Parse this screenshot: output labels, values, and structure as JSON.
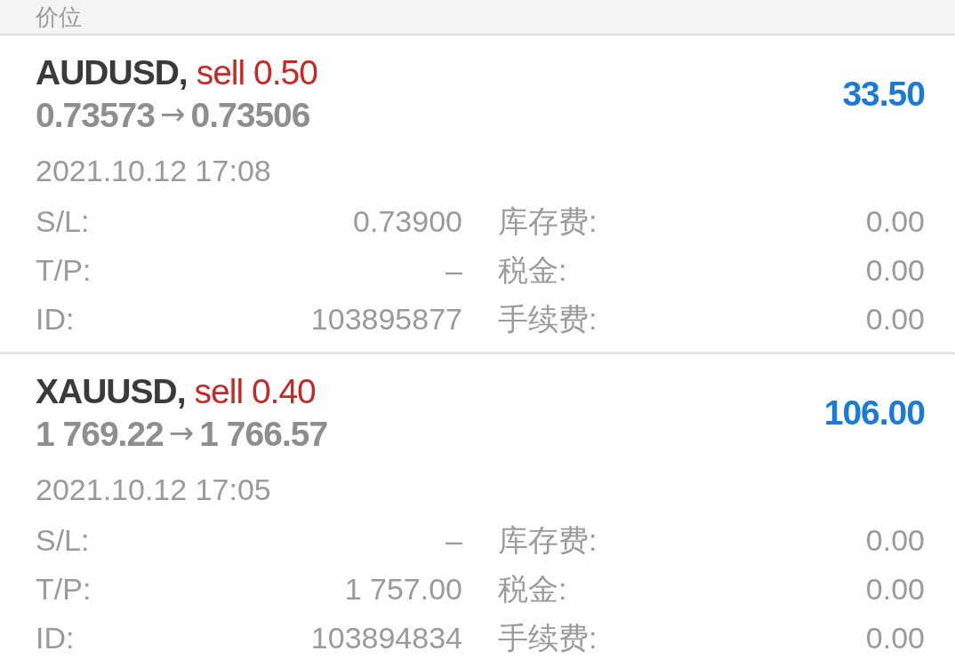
{
  "header": {
    "title": "价位"
  },
  "positions": [
    {
      "symbol": "AUDUSD,",
      "order": "sell 0.50",
      "open_price": "0.73573",
      "arrow": "→",
      "current_price": "0.73506",
      "profit": "33.50",
      "time": "2021.10.12 17:08",
      "details": [
        {
          "label": "S/L:",
          "value": "0.73900"
        },
        {
          "label": "库存费:",
          "value": "0.00"
        },
        {
          "label": "T/P:",
          "value": "–"
        },
        {
          "label": "税金:",
          "value": "0.00"
        },
        {
          "label": "ID:",
          "value": "103895877"
        },
        {
          "label": "手续费:",
          "value": "0.00"
        }
      ]
    },
    {
      "symbol": "XAUUSD,",
      "order": "sell 0.40",
      "open_price": "1 769.22",
      "arrow": "→",
      "current_price": "1 766.57",
      "profit": "106.00",
      "time": "2021.10.12 17:05",
      "details": [
        {
          "label": "S/L:",
          "value": "–"
        },
        {
          "label": "库存费:",
          "value": "0.00"
        },
        {
          "label": "T/P:",
          "value": "1 757.00"
        },
        {
          "label": "税金:",
          "value": "0.00"
        },
        {
          "label": "ID:",
          "value": "103894834"
        },
        {
          "label": "手续费:",
          "value": "0.00"
        }
      ]
    }
  ]
}
